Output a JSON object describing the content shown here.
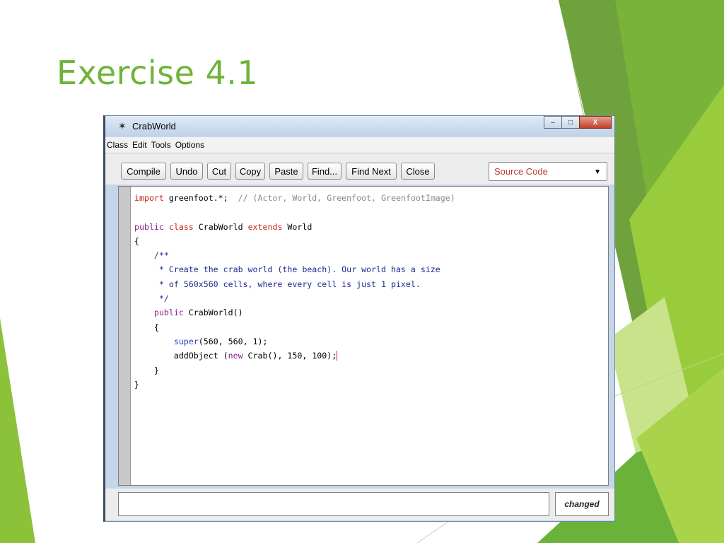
{
  "slide": {
    "title": "Exercise 4.1"
  },
  "window": {
    "icon": "greenfoot-icon",
    "title": "CrabWorld",
    "controls": {
      "minimize": "–",
      "maximize": "□",
      "close": "X"
    }
  },
  "menu": [
    "Class",
    "Edit",
    "Tools",
    "Options"
  ],
  "toolbar": {
    "buttons": [
      "Compile",
      "Undo",
      "Cut",
      "Copy",
      "Paste",
      "Find...",
      "Find Next",
      "Close"
    ],
    "view_select": "Source Code"
  },
  "code": {
    "lines": [
      [
        {
          "t": "import",
          "c": "kw"
        },
        {
          "t": " greenfoot.*;  "
        },
        {
          "t": "// (Actor, World, Greenfoot, GreenfootImage)",
          "c": "cm"
        }
      ],
      [],
      [
        {
          "t": "public",
          "c": "kw2"
        },
        {
          "t": " "
        },
        {
          "t": "class",
          "c": "kw"
        },
        {
          "t": " CrabWorld "
        },
        {
          "t": "extends",
          "c": "kw"
        },
        {
          "t": " World"
        }
      ],
      [
        {
          "t": "{"
        }
      ],
      [
        {
          "t": "    /**",
          "c": "doc"
        }
      ],
      [
        {
          "t": "     * Create the crab world (the beach). Our world has a size",
          "c": "doc"
        }
      ],
      [
        {
          "t": "     * of 560x560 cells, where every cell is just 1 pixel.",
          "c": "doc"
        }
      ],
      [
        {
          "t": "     */",
          "c": "doc"
        }
      ],
      [
        {
          "t": "    "
        },
        {
          "t": "public",
          "c": "kw2"
        },
        {
          "t": " CrabWorld()"
        }
      ],
      [
        {
          "t": "    {"
        }
      ],
      [
        {
          "t": "        "
        },
        {
          "t": "super",
          "c": "fn"
        },
        {
          "t": "(560, 560, 1);"
        }
      ],
      [
        {
          "t": "        addObject ("
        },
        {
          "t": "new",
          "c": "kw2"
        },
        {
          "t": " Crab(), 150, 100);"
        }
      ],
      [
        {
          "t": "    }"
        }
      ],
      [
        {
          "t": "}"
        }
      ]
    ]
  },
  "status": {
    "message": "",
    "changed": "changed"
  }
}
